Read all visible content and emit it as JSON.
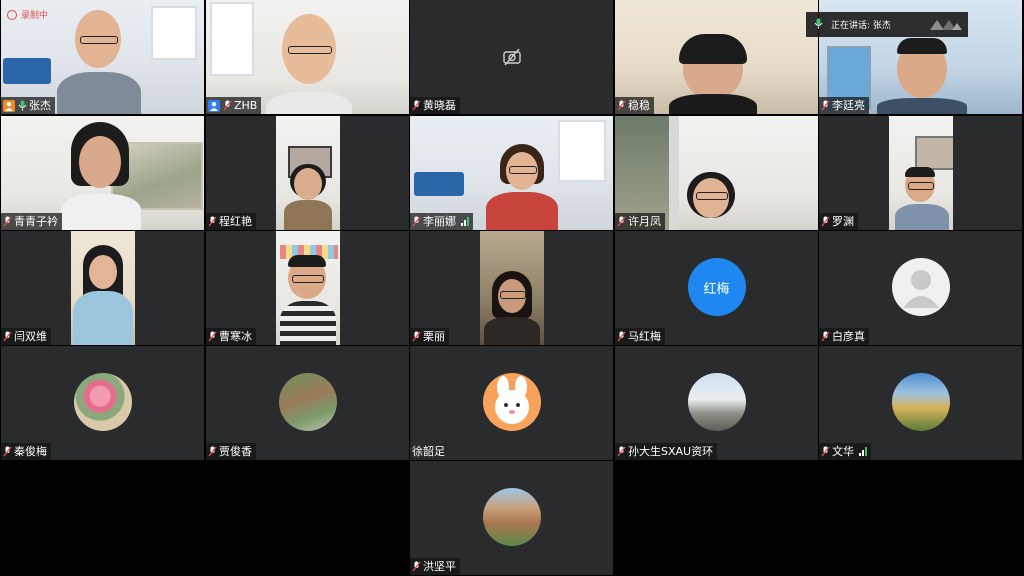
{
  "speaking": {
    "text": "正在讲话: 张杰"
  },
  "recording": {
    "text": "录制中"
  },
  "colors": {
    "host_orange": "#f08a24",
    "host_blue": "#2f7df6",
    "speaking_green": "#3cc46d",
    "avatar_blue": "#1e88f0",
    "tile_bg": "#2a2b2d"
  },
  "tiles": [
    {
      "name": "张杰",
      "host": "orange"
    },
    {
      "name": "ZHB",
      "host": "blue"
    },
    {
      "name": "黄晓磊"
    },
    {
      "name": "稳稳"
    },
    {
      "name": "李廷亮"
    },
    {
      "name": "青青子衿"
    },
    {
      "name": "程红艳"
    },
    {
      "name": "李丽娜"
    },
    {
      "name": "许月凤"
    },
    {
      "name": "罗渊"
    },
    {
      "name": "闫双维"
    },
    {
      "name": "曹寒冰"
    },
    {
      "name": "栗丽"
    },
    {
      "name": "马红梅",
      "avatar_text": "红梅"
    },
    {
      "name": "白彦真"
    },
    {
      "name": "秦俊梅"
    },
    {
      "name": "贾俊香"
    },
    {
      "name": "徐韶足"
    },
    {
      "name": "孙大生SXAU资环"
    },
    {
      "name": "文华"
    },
    {
      "name": "洪坚平"
    }
  ]
}
